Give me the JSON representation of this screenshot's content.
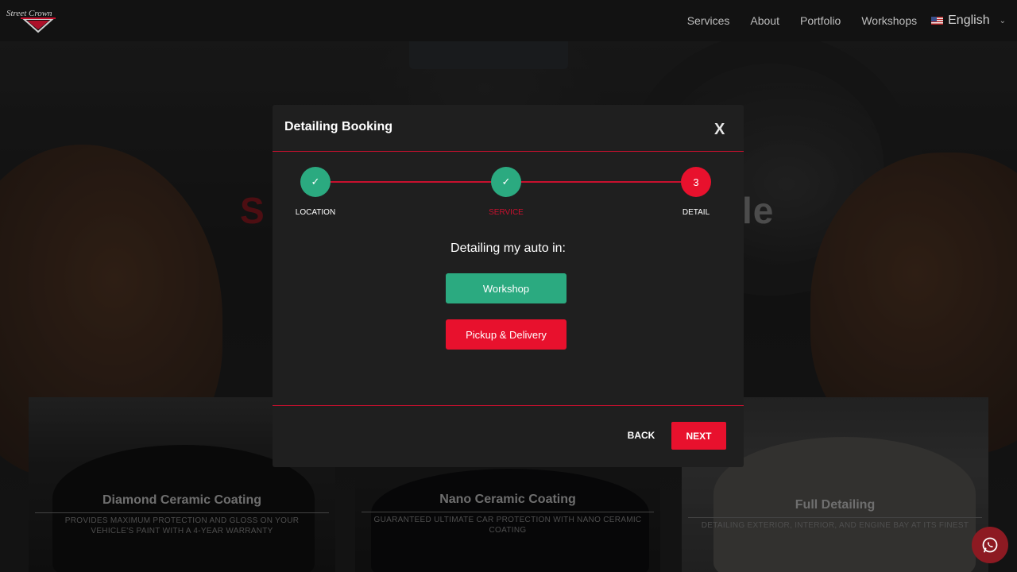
{
  "header": {
    "logo_text": "Street Crown",
    "nav": [
      "Services",
      "About",
      "Portfolio",
      "Workshops"
    ],
    "language": "English",
    "flag_icon": "us-flag-icon"
  },
  "hero": {
    "title_left": "S",
    "title_right": "le"
  },
  "cards": [
    {
      "title": "Diamond Ceramic Coating",
      "desc": "PROVIDES MAXIMUM PROTECTION AND GLOSS ON YOUR VEHICLE'S PAINT WITH A 4-YEAR WARRANTY"
    },
    {
      "title": "Nano Ceramic Coating",
      "desc": "GUARANTEED ULTIMATE CAR PROTECTION WITH NANO CERAMIC COATING"
    },
    {
      "title": "Full Detailing",
      "desc": "DETAILING EXTERIOR, INTERIOR, AND ENGINE BAY AT ITS FINEST"
    }
  ],
  "modal": {
    "title": "Detailing Booking",
    "close": "X",
    "steps": [
      {
        "label": "LOCATION",
        "mark": "✓",
        "state": "done"
      },
      {
        "label": "SERVICE",
        "mark": "✓",
        "state": "done"
      },
      {
        "label": "DETAIL",
        "mark": "3",
        "state": "current"
      }
    ],
    "question": "Detailing my auto in:",
    "options": [
      "Workshop",
      "Pickup & Delivery"
    ],
    "back": "BACK",
    "next": "NEXT"
  },
  "colors": {
    "accent_red": "#e8112d",
    "accent_green": "#2baa80",
    "divider_red": "#c8102e"
  }
}
